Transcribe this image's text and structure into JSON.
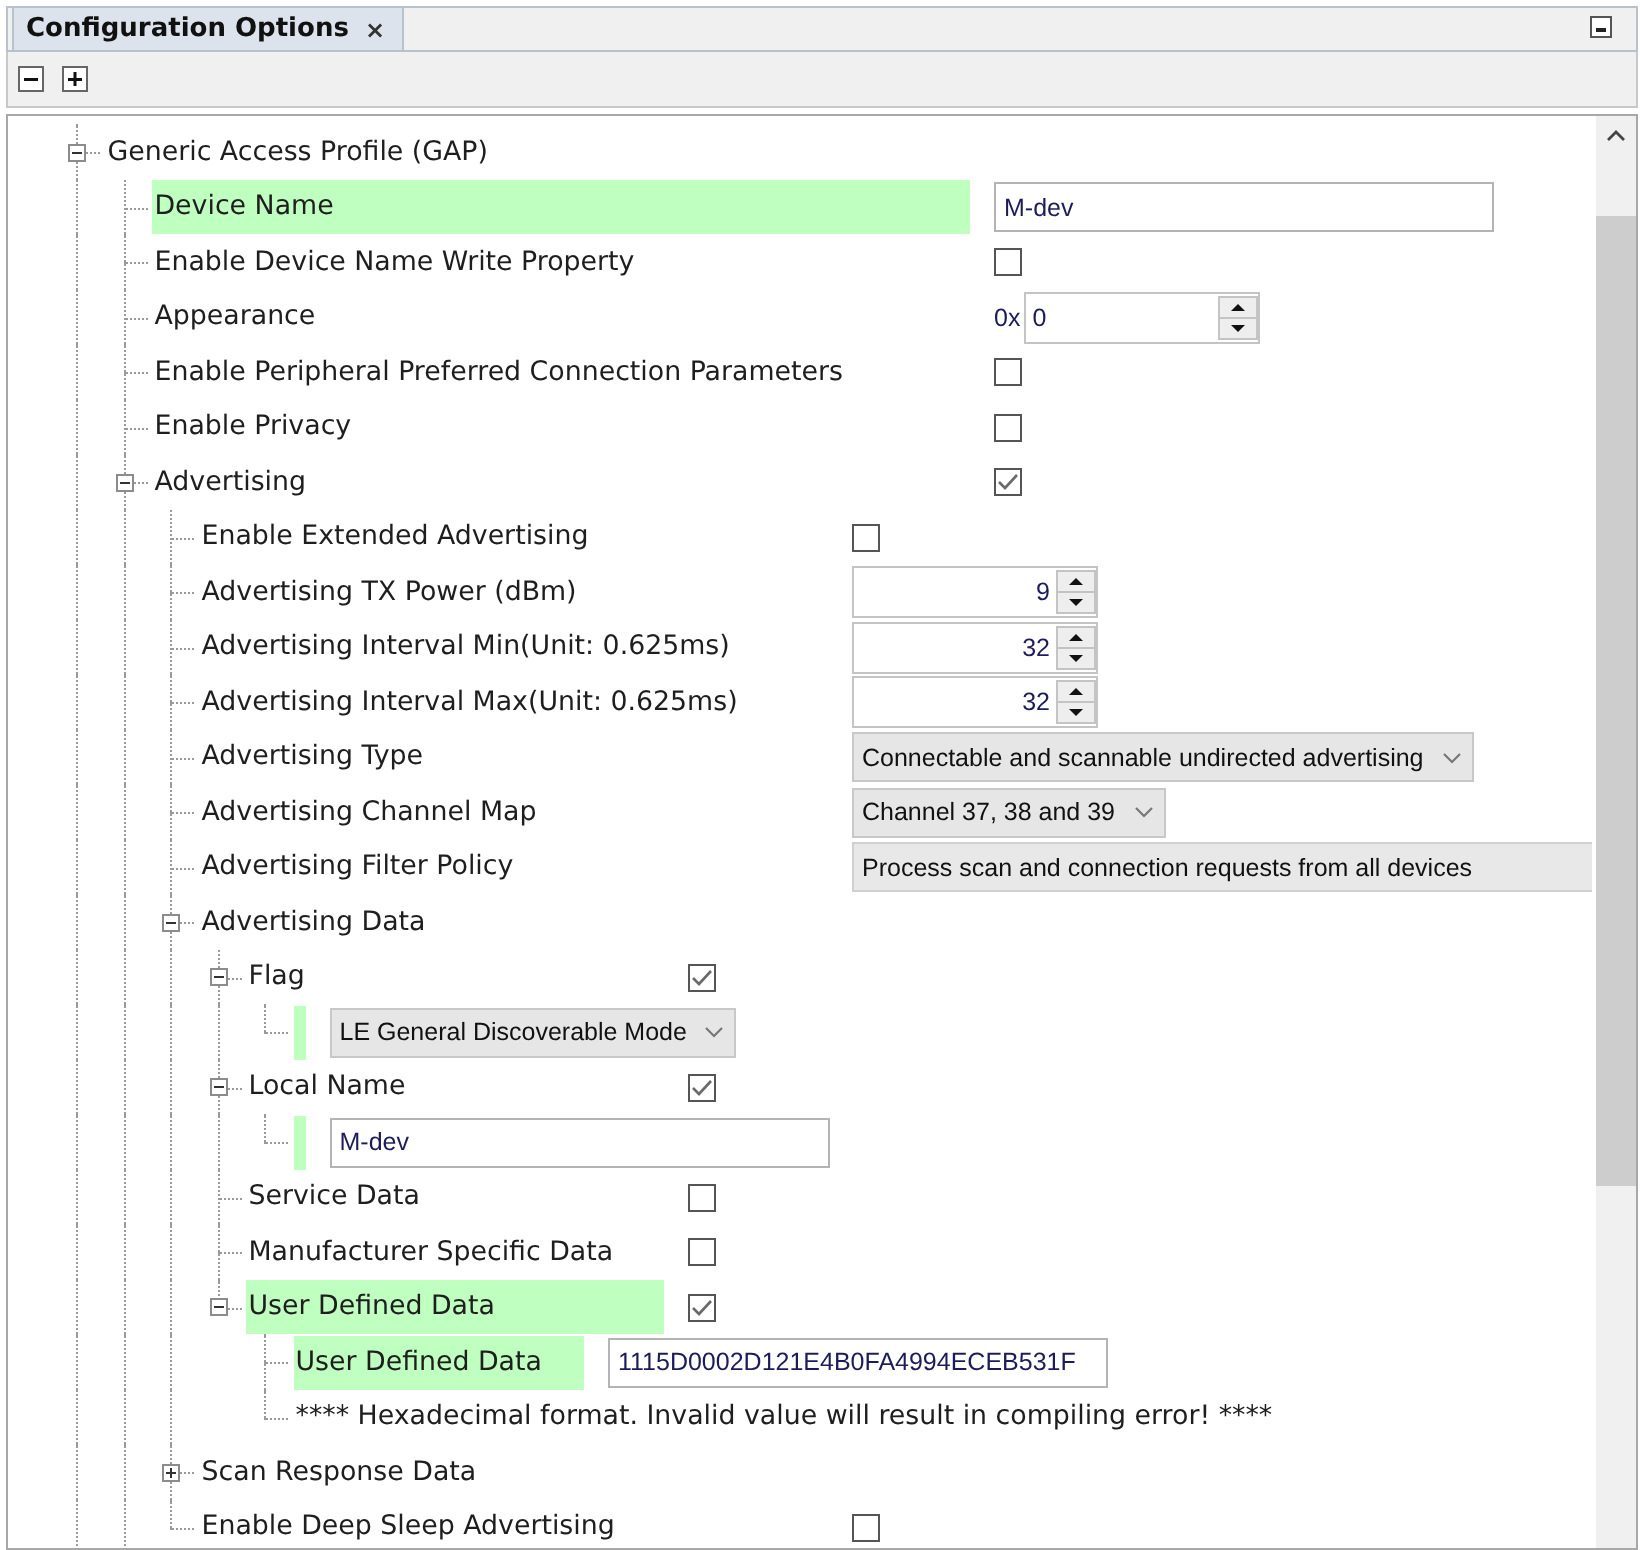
{
  "tab": {
    "title": "Configuration Options",
    "close": "×"
  },
  "tree_continues": true,
  "tree": [
    {
      "label": "Generic Access Profile (GAP)",
      "highlighted": false,
      "expanded": true,
      "children_continue": true,
      "children": [
        {
          "label": "Device Name",
          "highlighted": true,
          "control": {
            "kind": "text",
            "value": "M-dev"
          }
        },
        {
          "label": "Enable Device Name Write Property",
          "highlighted": false,
          "control": {
            "kind": "checkbox",
            "checked": false
          }
        },
        {
          "label": "Appearance",
          "highlighted": false,
          "control": {
            "kind": "hex",
            "prefix": "0x",
            "value": "0"
          }
        },
        {
          "label": "Enable Peripheral Preferred Connection Parameters",
          "highlighted": false,
          "control": {
            "kind": "checkbox",
            "checked": false
          }
        },
        {
          "label": "Enable Privacy",
          "highlighted": false,
          "control": {
            "kind": "checkbox",
            "checked": false
          }
        },
        {
          "label": "Advertising",
          "highlighted": false,
          "expanded": true,
          "control": {
            "kind": "checkbox",
            "checked": true
          },
          "children": [
            {
              "label": "Enable Extended Advertising",
              "highlighted": false,
              "control": {
                "kind": "checkbox",
                "checked": false
              }
            },
            {
              "label": "Advertising TX Power (dBm)",
              "highlighted": false,
              "control": {
                "kind": "spinner",
                "value": "9"
              }
            },
            {
              "label": "Advertising Interval Min(Unit: 0.625ms)",
              "highlighted": false,
              "control": {
                "kind": "spinner",
                "value": "32"
              }
            },
            {
              "label": "Advertising Interval Max(Unit: 0.625ms)",
              "highlighted": false,
              "control": {
                "kind": "spinner",
                "value": "32"
              }
            },
            {
              "label": "Advertising Type",
              "highlighted": false,
              "control": {
                "kind": "dropdown",
                "value": "Connectable and scannable undirected advertising"
              }
            },
            {
              "label": "Advertising Channel Map",
              "highlighted": false,
              "control": {
                "kind": "dropdown",
                "value": "Channel 37, 38 and 39"
              }
            },
            {
              "label": "Advertising Filter Policy",
              "highlighted": false,
              "control": {
                "kind": "readonly",
                "value": "Process scan and connection requests from all devices"
              }
            },
            {
              "label": "Advertising Data",
              "highlighted": false,
              "expanded": true,
              "children": [
                {
                  "label": "Flag",
                  "highlighted": false,
                  "expanded": true,
                  "control": {
                    "kind": "checkbox",
                    "checked": true
                  },
                  "children": [
                    {
                      "highlighted": true,
                      "control": {
                        "kind": "dropdown",
                        "value": "LE General Discoverable Mode"
                      }
                    }
                  ]
                },
                {
                  "label": "Local Name",
                  "highlighted": false,
                  "expanded": true,
                  "control": {
                    "kind": "checkbox",
                    "checked": true
                  },
                  "children": [
                    {
                      "highlighted": true,
                      "control": {
                        "kind": "text",
                        "value": "M-dev"
                      }
                    }
                  ]
                },
                {
                  "label": "Service Data",
                  "highlighted": false,
                  "control": {
                    "kind": "checkbox",
                    "checked": false
                  }
                },
                {
                  "label": "Manufacturer Specific Data",
                  "highlighted": false,
                  "control": {
                    "kind": "checkbox",
                    "checked": false
                  }
                },
                {
                  "label": "User Defined Data",
                  "highlighted": true,
                  "expanded": true,
                  "control": {
                    "kind": "checkbox",
                    "checked": true
                  },
                  "children": [
                    {
                      "label": "User Defined Data",
                      "highlighted": true,
                      "control": {
                        "kind": "text",
                        "value": "1115D0002D121E4B0FA4994ECEB531F"
                      }
                    },
                    {
                      "label": "**** Hexadecimal format. Invalid value will result in compiling error! ****",
                      "highlighted": false
                    }
                  ]
                }
              ]
            },
            {
              "label": "Scan Response Data",
              "highlighted": false,
              "expanded": false
            },
            {
              "label": "Enable Deep Sleep Advertising",
              "highlighted": false,
              "control": {
                "kind": "checkbox",
                "checked": false
              }
            }
          ]
        }
      ]
    }
  ]
}
